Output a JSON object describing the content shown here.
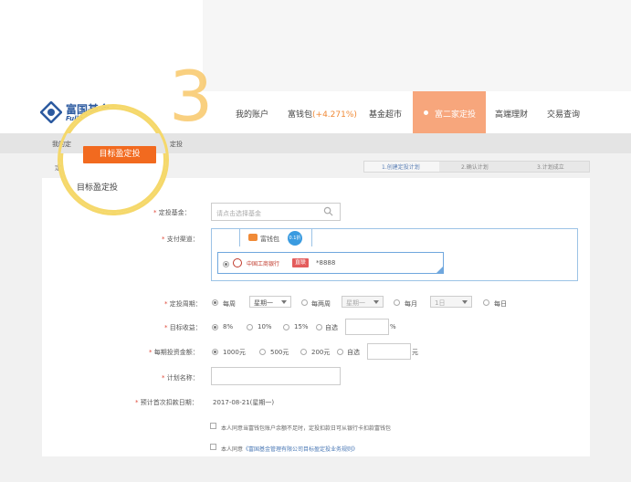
{
  "brand": {
    "name_cn": "富国基金",
    "name_en": "Fullgoal Fund",
    "color": "#2c5aa0"
  },
  "step_number": "3",
  "nav": {
    "items": [
      {
        "label": "我的账户"
      },
      {
        "label": "富钱包",
        "extra": "(+4.271%)"
      },
      {
        "label": "基金超市"
      },
      {
        "label": "富二家定投",
        "active": true
      },
      {
        "label": "高端理财"
      },
      {
        "label": "交易查询"
      }
    ]
  },
  "subnav": {
    "left": "我的定",
    "right": "定投"
  },
  "spotlight": {
    "button": "目标盈定投",
    "text": "目标盈定投"
  },
  "breadcrumb": "定投",
  "steps": [
    "1.创建定投计划",
    "2.确认计划",
    "3.计划成立"
  ],
  "form": {
    "fund": {
      "label": "定投基金：",
      "placeholder": "请点击选择基金"
    },
    "payment": {
      "label": "支付渠道：",
      "tab_label": "富钱包",
      "tab_badge": "0.1折",
      "bank_name": "中国工商银行",
      "bank_tag": "直联",
      "bank_number": "*8888"
    },
    "period": {
      "label": "定投周期：",
      "options": [
        "每周",
        "每两周",
        "每月",
        "每日"
      ],
      "selects": [
        "星期一",
        "星期一",
        "1日"
      ]
    },
    "target": {
      "label": "目标收益：",
      "options": [
        "8%",
        "10%",
        "15%",
        "自选"
      ],
      "unit": "%"
    },
    "amount": {
      "label": "每期投资金额：",
      "options": [
        "1000元",
        "500元",
        "200元",
        "自选"
      ],
      "unit": "元"
    },
    "plan_name": {
      "label": "计划名称："
    },
    "first_date": {
      "label": "预计首次扣款日期：",
      "value": "2017-08-21(星期一)"
    },
    "agree1": "本人同意当富钱包账户余额不足时，定投扣款日可从银行卡扣款富钱包",
    "agree2_prefix": "本人同意",
    "agree2_link": "《富国基金管理有限公司目标盈定投业务规则》"
  }
}
